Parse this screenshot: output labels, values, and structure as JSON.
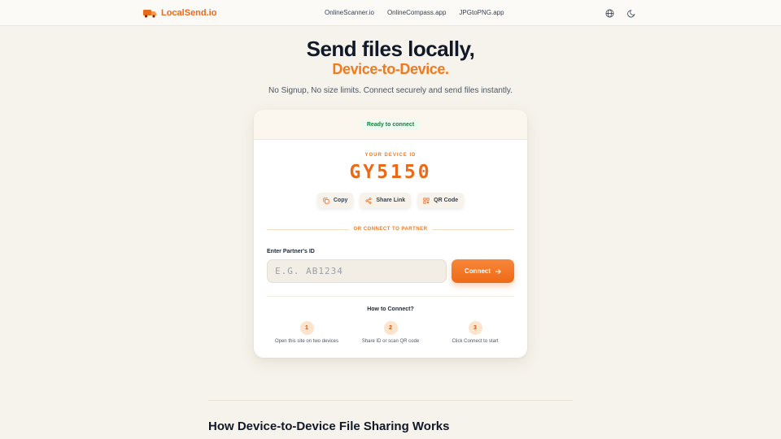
{
  "header": {
    "brand": "LocalSend.io",
    "nav": [
      "OnlineScanner.io",
      "OnlineCompass.app",
      "JPGtoPNG.app"
    ],
    "icons": [
      "globe-icon",
      "moon-icon"
    ]
  },
  "hero": {
    "title": "Send files locally,",
    "subtitle": "Device-to-Device.",
    "description": "No Signup, No size limits. Connect securely and send files instantly."
  },
  "card": {
    "status": "Ready to connect",
    "device_label": "YOUR DEVICE ID",
    "device_id": "GY5150",
    "actions": {
      "copy": "Copy",
      "share": "Share Link",
      "qr": "QR Code"
    },
    "divider": "OR CONNECT TO PARTNER",
    "partner_label": "Enter Partner's ID",
    "partner_placeholder": "E.G. AB1234",
    "partner_value": "",
    "connect_label": "Connect",
    "how_title": "How to Connect?",
    "steps": [
      {
        "num": "1",
        "label": "Open this site on two devices"
      },
      {
        "num": "2",
        "label": "Share ID or scan QR code"
      },
      {
        "num": "3",
        "label": "Click Connect to start"
      }
    ]
  },
  "section": {
    "title": "How Device-to-Device File Sharing Works"
  },
  "colors": {
    "accent": "#f07a1e",
    "background": "#f6f3ec",
    "status_green": "#16803c"
  }
}
